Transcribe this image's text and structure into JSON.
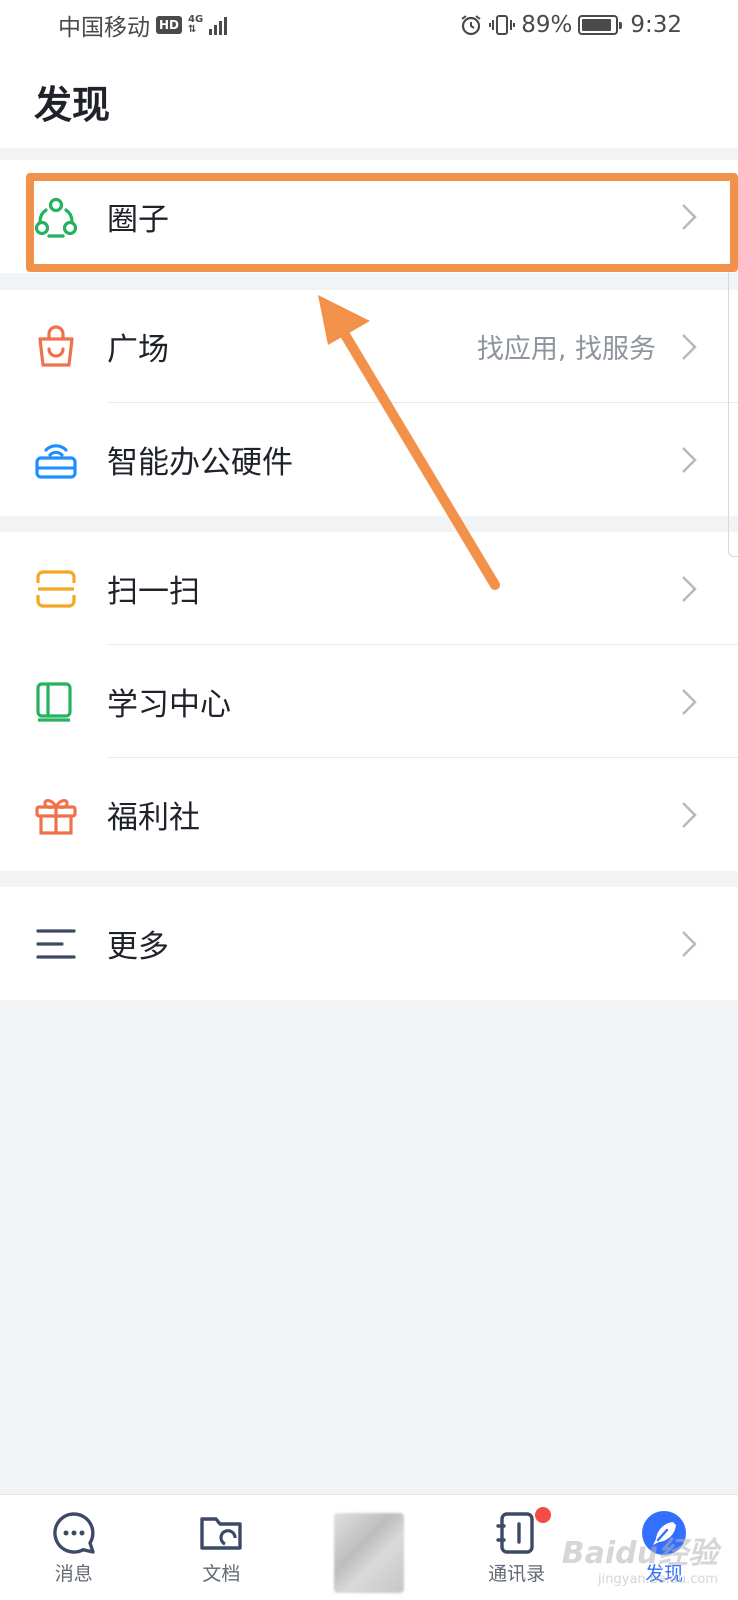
{
  "status_bar": {
    "carrier": "中国移动",
    "hd": "HD",
    "network": "4G",
    "battery": "89%",
    "battery_level": 0.89,
    "time": "9:32"
  },
  "header": {
    "title": "发现"
  },
  "groups": [
    {
      "items": [
        {
          "label": "圈子",
          "icon": "circle-group-icon",
          "color": "#25b15f"
        }
      ]
    },
    {
      "items": [
        {
          "label": "广场",
          "hint": "找应用, 找服务",
          "icon": "shopping-bag-icon",
          "color": "#f0714a"
        },
        {
          "label": "智能办公硬件",
          "icon": "router-device-icon",
          "color": "#1f8fff"
        }
      ]
    },
    {
      "items": [
        {
          "label": "扫一扫",
          "icon": "scan-icon",
          "color": "#f5a623"
        },
        {
          "label": "学习中心",
          "icon": "book-icon",
          "color": "#25b15f"
        },
        {
          "label": "福利社",
          "icon": "gift-icon",
          "color": "#f0714a"
        }
      ]
    },
    {
      "items": [
        {
          "label": "更多",
          "icon": "menu-lines-icon",
          "color": "#3d4a66"
        }
      ]
    }
  ],
  "tabbar": {
    "tabs": [
      {
        "label": "消息",
        "icon": "chat-icon"
      },
      {
        "label": "文档",
        "icon": "folder-icon"
      },
      {
        "label": "",
        "icon": "blurred-avatar"
      },
      {
        "label": "通讯录",
        "icon": "contacts-icon",
        "badge": true
      },
      {
        "label": "发现",
        "icon": "discover-icon",
        "active": true
      }
    ]
  },
  "watermark": {
    "text": "Baidu经验",
    "sub": "jingyan.baidu.com"
  },
  "colors": {
    "accent": "#3370ff",
    "highlight": "#f2914a",
    "badge": "#f54a45"
  }
}
